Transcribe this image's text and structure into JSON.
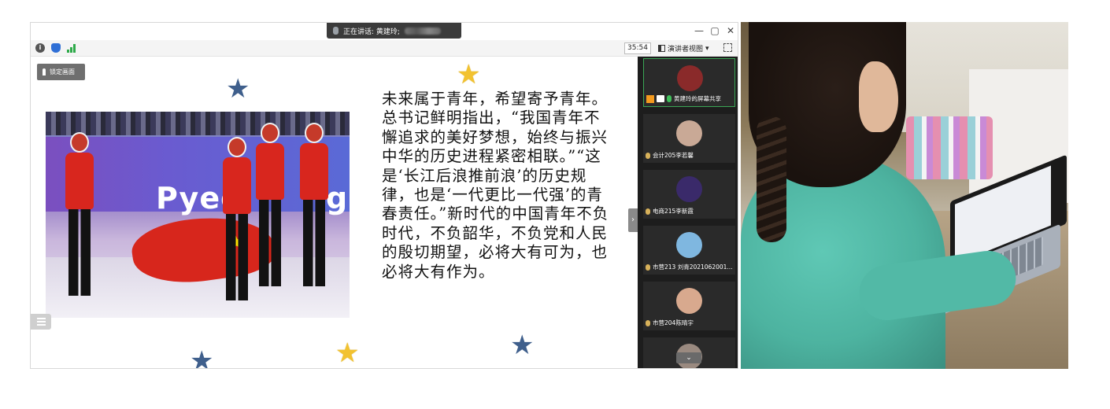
{
  "meeting": {
    "speaking_banner": "正在讲话: 黄建玲;",
    "window_controls": {
      "minimize": "—",
      "restore": "▢",
      "close": "✕"
    },
    "toolbar": {
      "timer": "35:54",
      "view_label": "演讲者视图",
      "view_caret": "▾",
      "icons": [
        "info-icon",
        "shield-icon",
        "signal-icon",
        "fullscreen-icon"
      ]
    },
    "lock_button": "锁定画面",
    "slide": {
      "paragraph": "未来属于青年，希望寄予青年。总书记鲜明指出，“我国青年不懈追求的美好梦想，始终与振兴中华的历史进程紧密相联。”“这是‘长江后浪推前浪’的历史规律，也是‘一代更比一代强’的青春责任。”新时代的中国青年不负时代，不负韶华，不负党和人民的殷切期望，必将大有可为，也必将大有作为。",
      "photo_text": "Pyeo",
      "photo_text_2": "g",
      "star_glyph": "★"
    },
    "collapse_glyph": "›",
    "participants": [
      {
        "name": "黄建玲的屏幕共享",
        "avatar_color": "#8a2a2a",
        "active": true
      },
      {
        "name": "会计205李若馨",
        "avatar_color": "#c9a996",
        "active": false
      },
      {
        "name": "电商215李新霞",
        "avatar_color": "#3a2a6a",
        "active": false
      },
      {
        "name": "市营213 刘青2021062001...",
        "avatar_color": "#7fb7e0",
        "active": false
      },
      {
        "name": "市营204陈晴宇",
        "avatar_color": "#d8a98e",
        "active": false
      }
    ],
    "scroll_glyph": "⌄"
  },
  "colors": {
    "panel_bg": "#1d1d1d",
    "active_border": "#3aa655",
    "star_blue": "#3f5f8c",
    "star_gold": "#f2c230"
  }
}
